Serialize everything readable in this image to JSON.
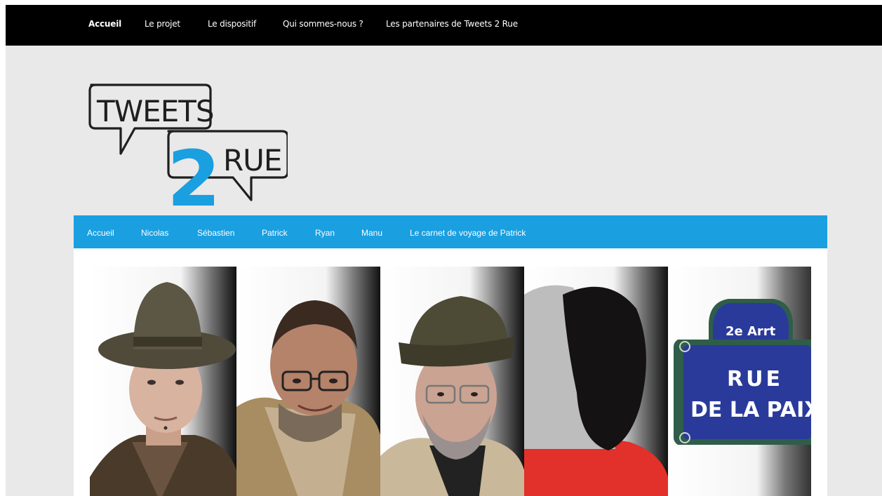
{
  "topnav": {
    "items": [
      {
        "label": "Accueil",
        "active": true
      },
      {
        "label": "Le projet"
      },
      {
        "label": "Le dispositif"
      },
      {
        "label": "Qui sommes-nous ?"
      },
      {
        "label": "Les partenaires de Tweets 2 Rue"
      }
    ]
  },
  "logo": {
    "line1": "TWEETS",
    "digit": "2",
    "line2": "RUE"
  },
  "subnav": {
    "items": [
      {
        "label": "Accueil"
      },
      {
        "label": "Nicolas"
      },
      {
        "label": "Sébastien"
      },
      {
        "label": "Patrick"
      },
      {
        "label": "Ryan"
      },
      {
        "label": "Manu"
      },
      {
        "label": "Le carnet de voyage de Patrick"
      }
    ]
  },
  "banner": {
    "panels": [
      {
        "icon": "portrait-man-hat-icon"
      },
      {
        "icon": "portrait-man-glasses-icon"
      },
      {
        "icon": "portrait-man-cap-icon"
      },
      {
        "icon": "portrait-man-beanie-back-icon"
      },
      {
        "icon": "street-sign-icon"
      }
    ],
    "street_sign": {
      "arrondissement": "2e Arrt",
      "line1": "RUE",
      "line2": "DE LA PAIX"
    }
  },
  "colors": {
    "topbar": "#000000",
    "subnav": "#1a9fe0",
    "page_bg": "#e9e9e9",
    "accent_blue": "#1a9fe0",
    "sign_blue": "#2a3a9a",
    "sign_green": "#2f5d4a"
  }
}
